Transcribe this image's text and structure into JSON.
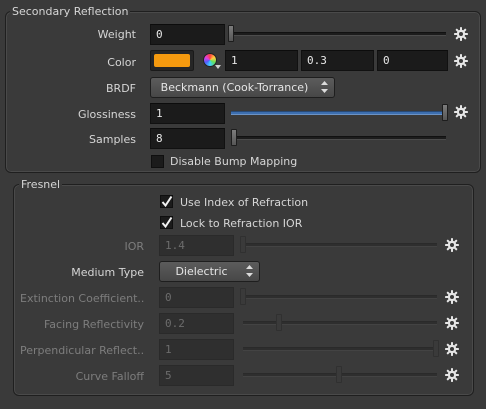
{
  "secondary_reflection": {
    "title": "Secondary Reflection",
    "weight": {
      "label": "Weight",
      "value": "0",
      "slider_fraction": 0.0
    },
    "color": {
      "label": "Color",
      "swatch": "#f59a0f",
      "r": "1",
      "g": "0.3",
      "b": "0"
    },
    "brdf": {
      "label": "BRDF",
      "value": "Beckmann (Cook-Torrance)"
    },
    "glossiness": {
      "label": "Glossiness",
      "value": "1",
      "slider_fraction": 1.0
    },
    "samples": {
      "label": "Samples",
      "value": "8",
      "slider_fraction": 0.0
    },
    "disable_bump": {
      "label": "Disable Bump Mapping",
      "checked": false
    }
  },
  "fresnel": {
    "title": "Fresnel",
    "use_ior": {
      "label": "Use Index of Refraction",
      "checked": true
    },
    "lock_ior": {
      "label": "Lock to Refraction IOR",
      "checked": true
    },
    "ior": {
      "label": "IOR",
      "value": "1.4",
      "slider_fraction": 0.0
    },
    "medium_type": {
      "label": "Medium Type",
      "value": "Dielectric"
    },
    "extinction": {
      "label": "Extinction Coefficient...",
      "value": "0",
      "slider_fraction": 0.0
    },
    "facing": {
      "label": "Facing Reflectivity",
      "value": "0.2",
      "slider_fraction": 0.2
    },
    "perpendicular": {
      "label": "Perpendicular Reflect...",
      "value": "1",
      "slider_fraction": 1.0
    },
    "curve_falloff": {
      "label": "Curve Falloff",
      "value": "5",
      "slider_fraction": 0.5
    }
  },
  "icons": {
    "gear": "gear-icon",
    "color_wheel": "color-wheel-icon",
    "checkmark": "checkmark-icon",
    "updown_arrows": "up-down-arrows-icon"
  },
  "colors": {
    "panel_bg": "#3a3a3a",
    "field_bg": "#1b1b1b",
    "accent_slider": "#3d6fb0",
    "disabled_text": "#7d7d7d"
  }
}
